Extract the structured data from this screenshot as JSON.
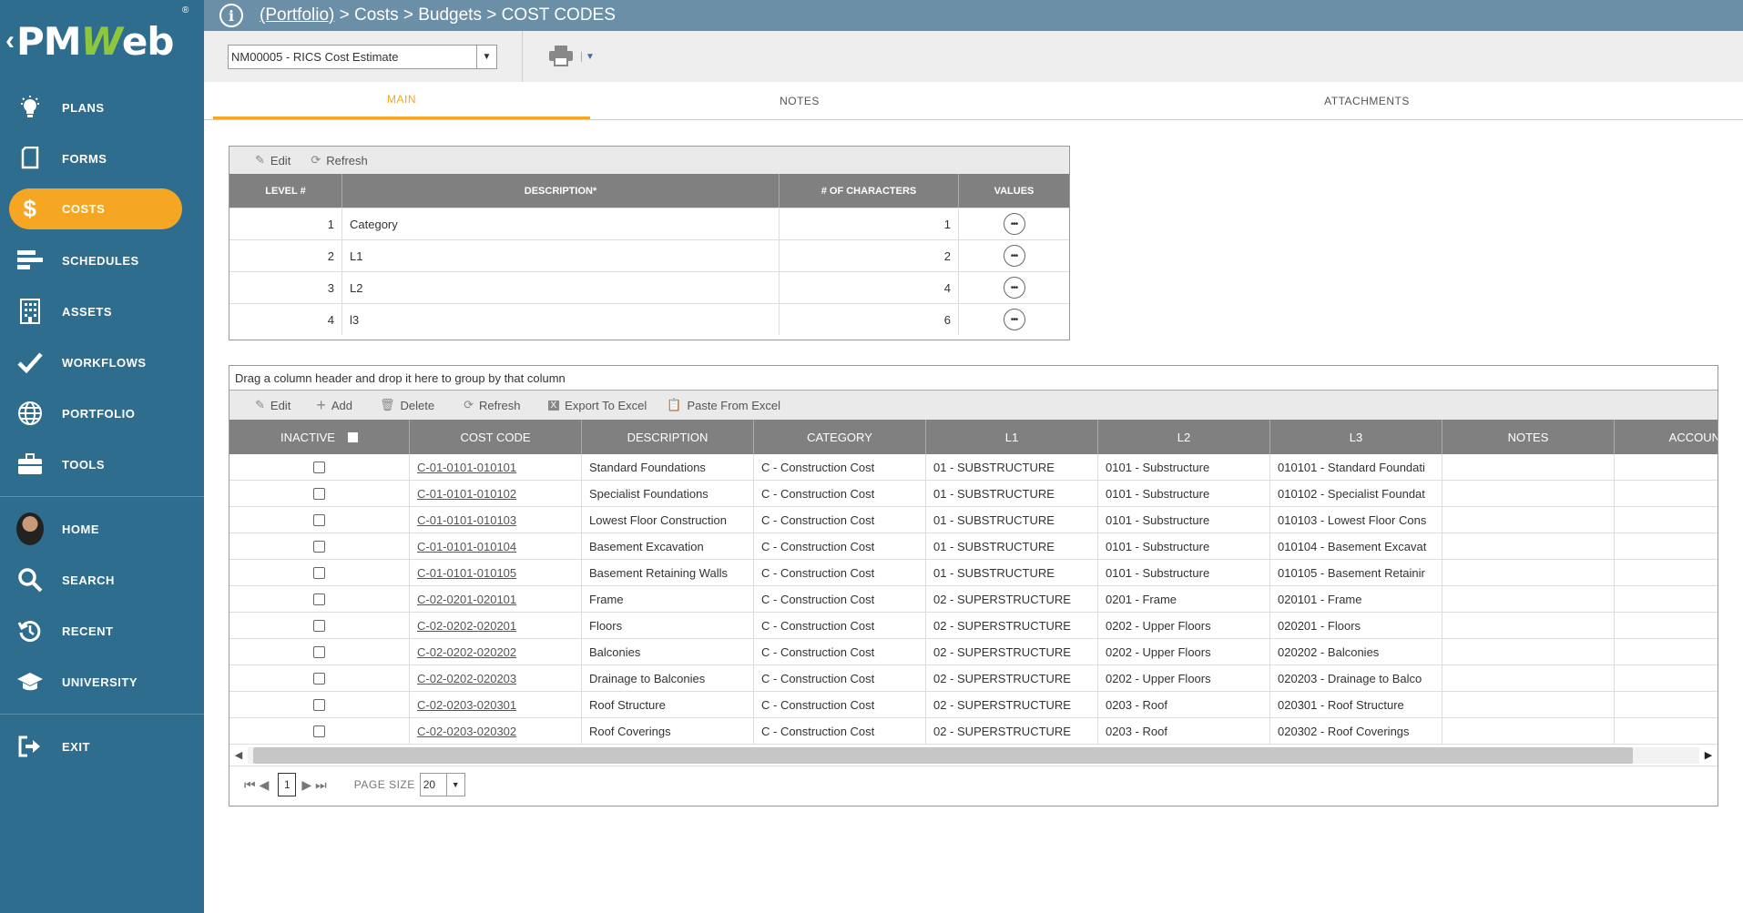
{
  "brand": {
    "logo_text": "PMWeb",
    "reg_mark": "®"
  },
  "colors": {
    "sidebar": "#2e6d8e",
    "active_nav": "#f5a623",
    "topbar": "#6c8fa8",
    "grid_header": "#808080"
  },
  "sidebar": {
    "items": [
      {
        "label": "PLANS",
        "icon": "lightbulb-icon"
      },
      {
        "label": "FORMS",
        "icon": "document-icon"
      },
      {
        "label": "COSTS",
        "icon": "dollar-icon",
        "active": true
      },
      {
        "label": "SCHEDULES",
        "icon": "gantt-icon"
      },
      {
        "label": "ASSETS",
        "icon": "building-icon"
      },
      {
        "label": "WORKFLOWS",
        "icon": "checkmark-icon"
      },
      {
        "label": "PORTFOLIO",
        "icon": "globe-icon"
      },
      {
        "label": "TOOLS",
        "icon": "briefcase-icon"
      }
    ],
    "home": "HOME",
    "search": "SEARCH",
    "recent": "RECENT",
    "university": "UNIVERSITY",
    "exit": "EXIT"
  },
  "breadcrumb": {
    "root": "(Portfolio)",
    "rest": " > Costs > Budgets > COST CODES"
  },
  "toolbar": {
    "record": "NM00005 - RICS Cost Estimate"
  },
  "tabs": [
    "MAIN",
    "NOTES",
    "ATTACHMENTS"
  ],
  "levels_grid": {
    "edit": "Edit",
    "refresh": "Refresh",
    "headers": [
      "LEVEL #",
      "DESCRIPTION*",
      "# OF CHARACTERS",
      "VALUES"
    ],
    "rows": [
      {
        "level": "1",
        "description": "Category",
        "chars": "1"
      },
      {
        "level": "2",
        "description": "L1",
        "chars": "2"
      },
      {
        "level": "3",
        "description": "L2",
        "chars": "4"
      },
      {
        "level": "4",
        "description": "l3",
        "chars": "6"
      }
    ]
  },
  "codes_grid": {
    "group_hint": "Drag a column header and drop it here to group by that column",
    "toolbar": {
      "edit": "Edit",
      "add": "Add",
      "delete": "Delete",
      "refresh": "Refresh",
      "export": "Export To Excel",
      "paste": "Paste From Excel"
    },
    "headers": [
      "INACTIVE",
      "COST CODE",
      "DESCRIPTION",
      "CATEGORY",
      "L1",
      "L2",
      "L3",
      "NOTES",
      "ACCOUN"
    ],
    "rows": [
      {
        "code": "C-01-0101-010101",
        "description": "Standard Foundations",
        "category": "C - Construction Cost",
        "l1": "01 - SUBSTRUCTURE",
        "l2": "0101 - Substructure",
        "l3": "010101 - Standard Foundati"
      },
      {
        "code": "C-01-0101-010102",
        "description": "Specialist Foundations",
        "category": "C - Construction Cost",
        "l1": "01 - SUBSTRUCTURE",
        "l2": "0101 - Substructure",
        "l3": "010102 - Specialist Foundat"
      },
      {
        "code": "C-01-0101-010103",
        "description": "Lowest Floor Construction",
        "category": "C - Construction Cost",
        "l1": "01 - SUBSTRUCTURE",
        "l2": "0101 - Substructure",
        "l3": "010103 - Lowest Floor Cons"
      },
      {
        "code": "C-01-0101-010104",
        "description": "Basement Excavation",
        "category": "C - Construction Cost",
        "l1": "01 - SUBSTRUCTURE",
        "l2": "0101 - Substructure",
        "l3": "010104 - Basement Excavat"
      },
      {
        "code": "C-01-0101-010105",
        "description": "Basement Retaining Walls",
        "category": "C - Construction Cost",
        "l1": "01 - SUBSTRUCTURE",
        "l2": "0101 - Substructure",
        "l3": "010105 - Basement Retainir"
      },
      {
        "code": "C-02-0201-020101",
        "description": "Frame",
        "category": "C - Construction Cost",
        "l1": "02 - SUPERSTRUCTURE",
        "l2": "0201 - Frame",
        "l3": "020101 - Frame"
      },
      {
        "code": "C-02-0202-020201",
        "description": "Floors",
        "category": "C - Construction Cost",
        "l1": "02 - SUPERSTRUCTURE",
        "l2": "0202 - Upper Floors",
        "l3": "020201 - Floors"
      },
      {
        "code": "C-02-0202-020202",
        "description": "Balconies",
        "category": "C - Construction Cost",
        "l1": "02 - SUPERSTRUCTURE",
        "l2": "0202 - Upper Floors",
        "l3": "020202 - Balconies"
      },
      {
        "code": "C-02-0202-020203",
        "description": "Drainage to Balconies",
        "category": "C - Construction Cost",
        "l1": "02 - SUPERSTRUCTURE",
        "l2": "0202 - Upper Floors",
        "l3": "020203 - Drainage to Balco"
      },
      {
        "code": "C-02-0203-020301",
        "description": "Roof Structure",
        "category": "C - Construction Cost",
        "l1": "02 - SUPERSTRUCTURE",
        "l2": "0203 - Roof",
        "l3": "020301 - Roof Structure"
      },
      {
        "code": "C-02-0203-020302",
        "description": "Roof Coverings",
        "category": "C - Construction Cost",
        "l1": "02 - SUPERSTRUCTURE",
        "l2": "0203 - Roof",
        "l3": "020302 - Roof Coverings"
      }
    ]
  },
  "pager": {
    "page": "1",
    "page_size_label": "PAGE SIZE",
    "page_size": "20"
  }
}
